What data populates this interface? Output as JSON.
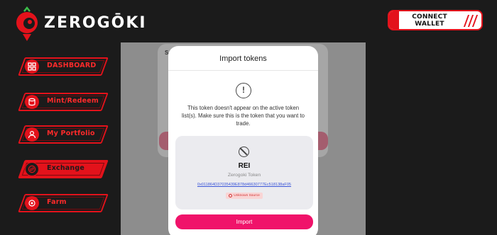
{
  "brand": {
    "name": "ZEROGŌKI"
  },
  "header": {
    "connect_label": "CONNECT WALLET"
  },
  "sidebar": {
    "items": [
      {
        "label": "DASHBOARD",
        "icon": "dashboard-icon"
      },
      {
        "label": "Mint/Redeem",
        "icon": "mint-icon"
      },
      {
        "label": "My Portfolio",
        "icon": "portfolio-icon"
      },
      {
        "label": "Exchange",
        "icon": "exchange-icon",
        "active": true
      },
      {
        "label": "Farm",
        "icon": "farm-icon"
      }
    ]
  },
  "background_card": {
    "partial_letter": "S"
  },
  "modal": {
    "title": "Import tokens",
    "warning": "This token doesn't appear on the active token list(s). Make sure this is the token that you want to trade.",
    "token": {
      "symbol": "REI",
      "name": "Zerogoki Token",
      "address": "0x011864D37035439E878d46630777Ec518138aF05",
      "badge": "Unknown Source"
    },
    "import_label": "Import"
  },
  "colors": {
    "accent": "#e3121b",
    "button": "#f0136a",
    "background": "#1b1b1b"
  }
}
